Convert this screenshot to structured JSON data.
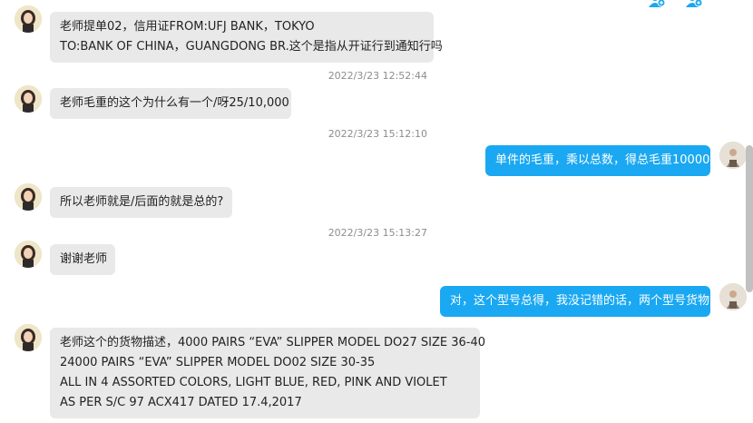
{
  "messages": [
    {
      "side": "in",
      "lines": [
        "老师提单02，信用证FROM:UFJ BANK，TOKYO",
        "TO:BANK OF CHINA，GUANGDONG BR.这个是指从开证行到通知行吗"
      ]
    },
    {
      "timestamp": "2022/3/23 12:52:44"
    },
    {
      "side": "in",
      "lines": [
        "老师毛重的这个为什么有一个/呀25/10,000"
      ]
    },
    {
      "timestamp": "2022/3/23 15:12:10"
    },
    {
      "side": "out",
      "lines": [
        "单件的毛重，乘以总数，得总毛重10000"
      ]
    },
    {
      "side": "in",
      "lines": [
        "所以老师就是/后面的就是总的?"
      ]
    },
    {
      "timestamp": "2022/3/23 15:13:27"
    },
    {
      "side": "in",
      "lines": [
        "谢谢老师"
      ]
    },
    {
      "side": "out",
      "lines": [
        "对，这个型号总得，我没记错的话，两个型号货物"
      ]
    },
    {
      "side": "in",
      "lines": [
        "老师这个的货物描述，4000 PAIRS “EVA” SLIPPER MODEL DO27 SIZE 36-40",
        "24000 PAIRS “EVA” SLIPPER MODEL DO02 SIZE 30-35",
        "ALL IN 4 ASSORTED COLORS, LIGHT BLUE, RED, PINK AND VIOLET",
        "AS PER S/C 97 ACX417 DATED 17.4,2017"
      ]
    }
  ],
  "colors": {
    "incoming_bubble": "#e9e9e9",
    "outgoing_bubble": "#1aa8f2",
    "timestamp": "#8d8d8d"
  },
  "icons": [
    "user-add-icon",
    "user-settings-icon"
  ]
}
